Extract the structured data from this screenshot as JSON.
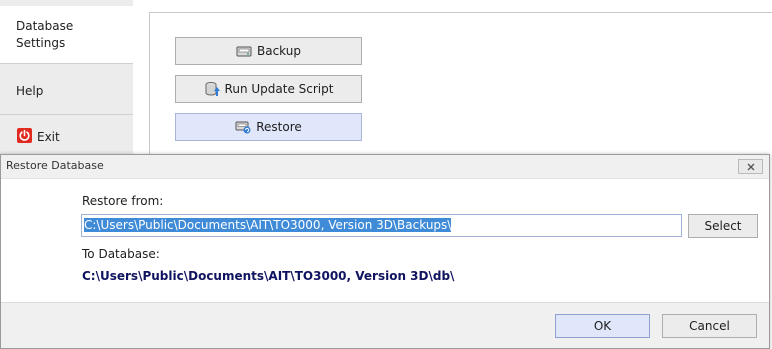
{
  "sidebar": {
    "items": [
      {
        "label_line1": "Database",
        "label_line2": "Settings",
        "active": true
      },
      {
        "label": "Help"
      },
      {
        "label": "Exit"
      }
    ]
  },
  "actions": {
    "backup": "Backup",
    "run_update_script": "Run Update Script",
    "restore": "Restore"
  },
  "dialog": {
    "title": "Restore Database",
    "restore_from_label": "Restore from:",
    "restore_from_value": "C:\\Users\\Public\\Documents\\AIT\\TO3000, Version 3D\\Backups\\",
    "select_label": "Select",
    "to_database_label": "To Database:",
    "to_database_value": "C:\\Users\\Public\\Documents\\AIT\\TO3000, Version 3D\\db\\",
    "ok_label": "OK",
    "cancel_label": "Cancel"
  },
  "colors": {
    "exit_icon": "#e02a20",
    "selection": "#3f8bd8",
    "database_path": "#101460",
    "hover_button": "#e1e7fb"
  }
}
